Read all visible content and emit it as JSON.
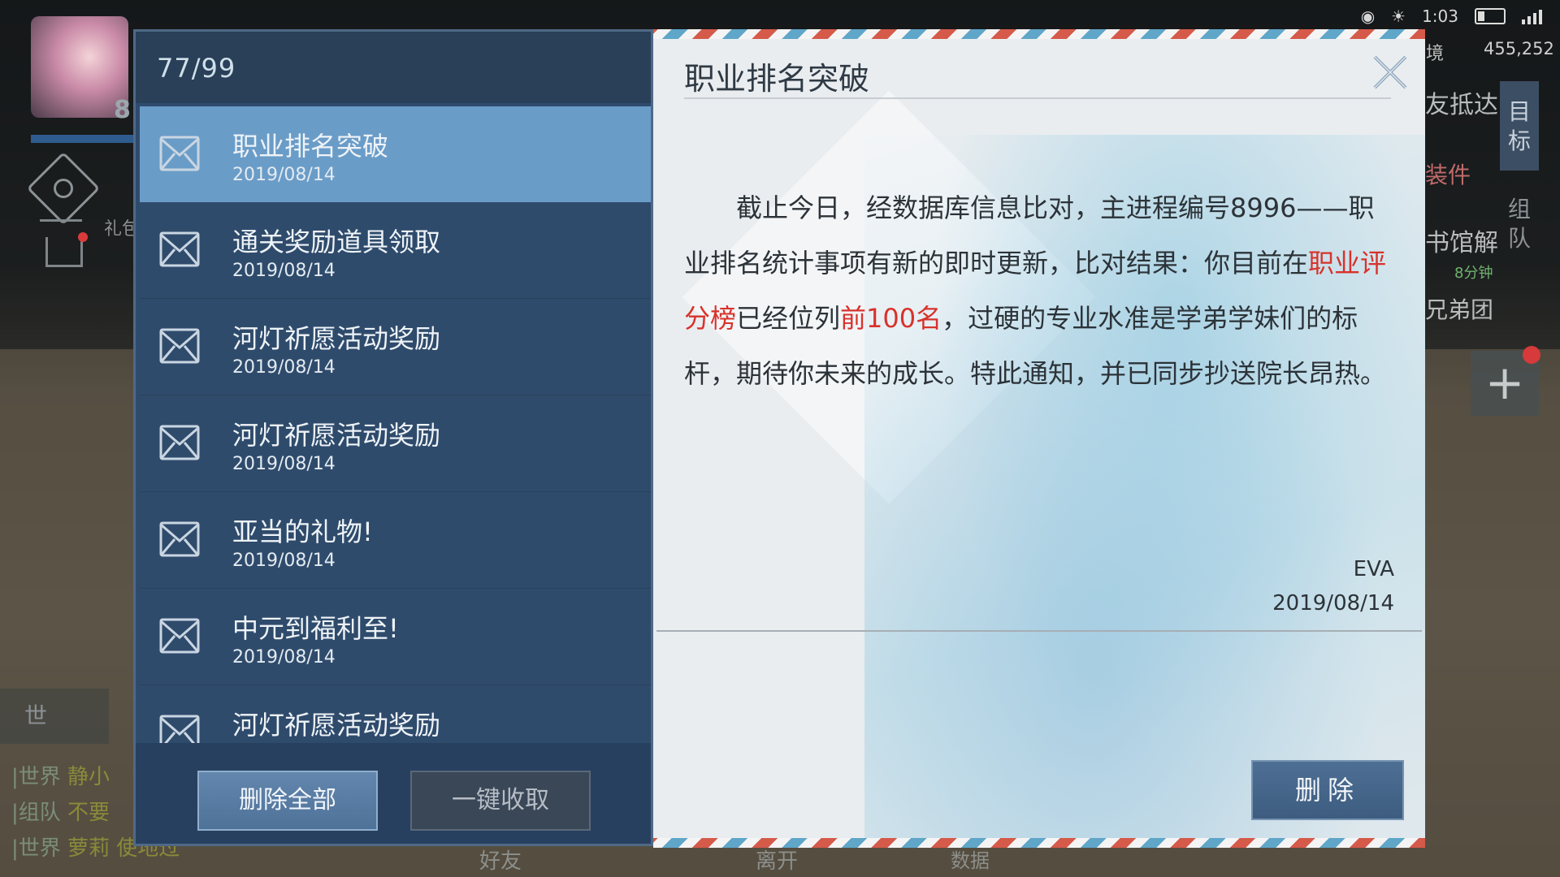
{
  "status": {
    "time": "1:03"
  },
  "hud": {
    "avatar_level": "8",
    "coins_label": "境",
    "coins": "455,252",
    "gift_label": "礼包",
    "right_texts": [
      "友抵达",
      "装件",
      "书馆解",
      "兄弟团"
    ],
    "right_timer": "8分钟",
    "tab_goal": "目标",
    "tab_team": "组队",
    "add_label": "+"
  },
  "chat": {
    "mic_label": "世",
    "lines": [
      {
        "channel": "|世界",
        "text": "静小"
      },
      {
        "channel": "|组队",
        "text": "不要"
      },
      {
        "channel": "|世界",
        "text": "萝莉 使地过"
      }
    ],
    "nav_friends": "好友",
    "nav_leave": "离开",
    "nav_data": "数据"
  },
  "mail_list": {
    "count": "77/99",
    "items": [
      {
        "title": "职业排名突破",
        "date": "2019/08/14",
        "selected": true
      },
      {
        "title": "通关奖励道具领取",
        "date": "2019/08/14"
      },
      {
        "title": "河灯祈愿活动奖励",
        "date": "2019/08/14"
      },
      {
        "title": "河灯祈愿活动奖励",
        "date": "2019/08/14"
      },
      {
        "title": "亚当的礼物!",
        "date": "2019/08/14"
      },
      {
        "title": "中元到福利至!",
        "date": "2019/08/14"
      },
      {
        "title": "河灯祈愿活动奖励",
        "date": ""
      }
    ],
    "delete_all_label": "删除全部",
    "collect_all_label": "一键收取"
  },
  "letter": {
    "title": "职业排名突破",
    "body_part1": "　　截止今日，经数据库信息比对，主进程编号8996——职业排名统计事项有新的即时更新，比对结果：你目前在",
    "body_red1": "职业评分榜",
    "body_part2": "已经位列",
    "body_red2": "前100名",
    "body_part3": "，过硬的专业水准是学弟学妹们的标杆，期待你未来的成长。特此通知，并已同步抄送院长昂热。",
    "sender": "EVA",
    "date": "2019/08/14",
    "delete_label": "删除"
  },
  "colors": {
    "accent_red": "#d8322b",
    "list_bg": "#2f4b6c",
    "selected_bg": "#6a9cc8"
  }
}
